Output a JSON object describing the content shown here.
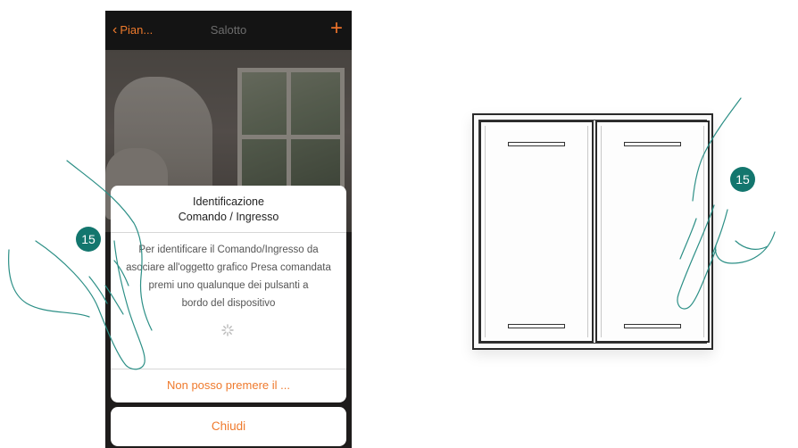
{
  "navbar": {
    "back_label": "Pian...",
    "title": "Salotto",
    "add_label": "+"
  },
  "dialog": {
    "title_line1": "Identificazione",
    "title_line2": "Comando / Ingresso",
    "message_line1": "Per identificare il Comando/Ingresso da",
    "message_line2": "asociare all'oggetto grafico Presa comandata",
    "message_line3": "premi uno qualunque dei pulsanti a",
    "message_line4": "bordo del dispositivo",
    "action_label": "Non posso premere il ..."
  },
  "cancel_button": {
    "label": "Chiudi"
  },
  "step_badges": {
    "left": "15",
    "right": "15"
  },
  "colors": {
    "accent": "#ef7a2d",
    "badge": "#13766e",
    "navbar": "#141414"
  },
  "icons": [
    "chevron-left-icon",
    "plus-icon",
    "spinner-icon",
    "hand-icon"
  ]
}
